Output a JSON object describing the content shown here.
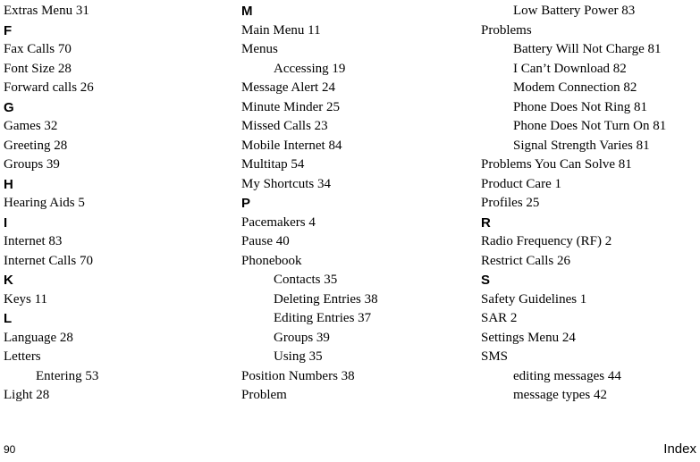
{
  "footer": {
    "page": "90",
    "label": "Index"
  },
  "col1": [
    {
      "t": "entry",
      "text": "Extras Menu 31"
    },
    {
      "t": "heading",
      "text": "F"
    },
    {
      "t": "entry",
      "text": "Fax Calls 70"
    },
    {
      "t": "entry",
      "text": "Font Size 28"
    },
    {
      "t": "entry",
      "text": "Forward calls 26"
    },
    {
      "t": "heading",
      "text": "G"
    },
    {
      "t": "entry",
      "text": "Games 32"
    },
    {
      "t": "entry",
      "text": "Greeting 28"
    },
    {
      "t": "entry",
      "text": "Groups 39"
    },
    {
      "t": "heading",
      "text": "H"
    },
    {
      "t": "entry",
      "text": "Hearing Aids 5"
    },
    {
      "t": "heading",
      "text": "I"
    },
    {
      "t": "entry",
      "text": "Internet 83"
    },
    {
      "t": "entry",
      "text": "Internet Calls 70"
    },
    {
      "t": "heading",
      "text": "K"
    },
    {
      "t": "entry",
      "text": "Keys 11"
    },
    {
      "t": "heading",
      "text": "L"
    },
    {
      "t": "entry",
      "text": "Language 28"
    },
    {
      "t": "entry",
      "text": "Letters"
    },
    {
      "t": "sub",
      "text": "Entering 53"
    },
    {
      "t": "entry",
      "text": "Light 28"
    }
  ],
  "col2": [
    {
      "t": "heading",
      "text": "M"
    },
    {
      "t": "entry",
      "text": "Main Menu 11"
    },
    {
      "t": "entry",
      "text": "Menus"
    },
    {
      "t": "sub",
      "text": "Accessing 19"
    },
    {
      "t": "entry",
      "text": "Message Alert 24"
    },
    {
      "t": "entry",
      "text": "Minute Minder 25"
    },
    {
      "t": "entry",
      "text": "Missed Calls 23"
    },
    {
      "t": "entry",
      "text": "Mobile Internet 84"
    },
    {
      "t": "entry",
      "text": "Multitap 54"
    },
    {
      "t": "entry",
      "text": "My Shortcuts 34"
    },
    {
      "t": "heading",
      "text": "P"
    },
    {
      "t": "entry",
      "text": "Pacemakers 4"
    },
    {
      "t": "entry",
      "text": "Pause 40"
    },
    {
      "t": "entry",
      "text": "Phonebook"
    },
    {
      "t": "sub",
      "text": "Contacts 35"
    },
    {
      "t": "sub",
      "text": "Deleting Entries 38"
    },
    {
      "t": "sub",
      "text": "Editing Entries 37"
    },
    {
      "t": "sub",
      "text": "Groups 39"
    },
    {
      "t": "sub",
      "text": "Using 35"
    },
    {
      "t": "entry",
      "text": "Position Numbers 38"
    },
    {
      "t": "entry",
      "text": "Problem"
    }
  ],
  "col3": [
    {
      "t": "sub",
      "text": "Low Battery Power 83"
    },
    {
      "t": "entry",
      "text": "Problems"
    },
    {
      "t": "sub",
      "text": "Battery Will Not Charge 81"
    },
    {
      "t": "sub",
      "text": "I Can’t Download 82"
    },
    {
      "t": "sub",
      "text": "Modem Connection 82"
    },
    {
      "t": "sub",
      "text": "Phone Does Not Ring 81"
    },
    {
      "t": "sub",
      "text": "Phone Does Not Turn On 81"
    },
    {
      "t": "sub",
      "text": "Signal Strength Varies 81"
    },
    {
      "t": "entry",
      "text": "Problems You Can Solve 81"
    },
    {
      "t": "entry",
      "text": "Product Care 1"
    },
    {
      "t": "entry",
      "text": "Profiles 25"
    },
    {
      "t": "heading",
      "text": "R"
    },
    {
      "t": "entry",
      "text": "Radio Frequency (RF) 2"
    },
    {
      "t": "entry",
      "text": "Restrict Calls 26"
    },
    {
      "t": "heading",
      "text": "S"
    },
    {
      "t": "entry",
      "text": "Safety Guidelines 1"
    },
    {
      "t": "entry",
      "text": "SAR 2"
    },
    {
      "t": "entry",
      "text": "Settings Menu 24"
    },
    {
      "t": "entry",
      "text": "SMS"
    },
    {
      "t": "sub",
      "text": "editing messages 44"
    },
    {
      "t": "sub",
      "text": "message types 42"
    }
  ]
}
